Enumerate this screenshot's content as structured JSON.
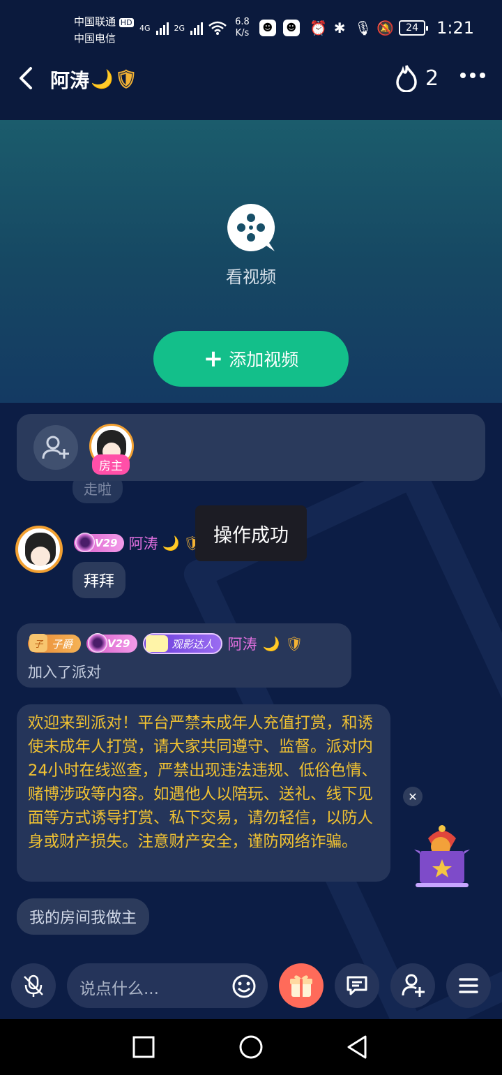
{
  "status_bar": {
    "carrier_1": "中国联通",
    "carrier_2": "中国电信",
    "hd": "HD",
    "net_1": "4G",
    "net_2": "2G",
    "speed_value": "6.8",
    "speed_unit": "K/s",
    "battery": "24",
    "time": "1:21"
  },
  "header": {
    "title": "阿涛",
    "title_emoji_1": "🌙",
    "title_emoji_2": "🛡",
    "fire_count": "2"
  },
  "video": {
    "label": "看视频",
    "add_button_label": "添加视频"
  },
  "members": {
    "host_badge": "房主"
  },
  "chat": {
    "faded_message": "走啦",
    "toast": "操作成功",
    "msg_level": "V29",
    "msg_user": "阿涛",
    "msg_text": "拜拜",
    "join_badge_title": "子爵",
    "join_level": "V29",
    "join_fan_badge": "观影达人",
    "join_user": "阿涛",
    "join_text": "加入了派对",
    "notice": "欢迎来到派对！平台严禁未成年人充值打赏，和诱使未成年人打赏，请大家共同遵守、监督。派对内24小时在线巡查，严禁出现违法违规、低俗色情、赌博涉政等内容。如遇他人以陪玩、送礼、线下见面等方式诱导打赏、私下交易，请勿轻信，以防人身或财产损失。注意财产安全，谨防网络诈骗。",
    "room_tag": "我的房间我做主"
  },
  "toolbar": {
    "input_placeholder": "说点什么..."
  },
  "colors": {
    "accent_green": "#13bf8a",
    "notice_text": "#f1c232",
    "name_pink": "#e270e0",
    "gift_button": "#ff6b5a"
  }
}
